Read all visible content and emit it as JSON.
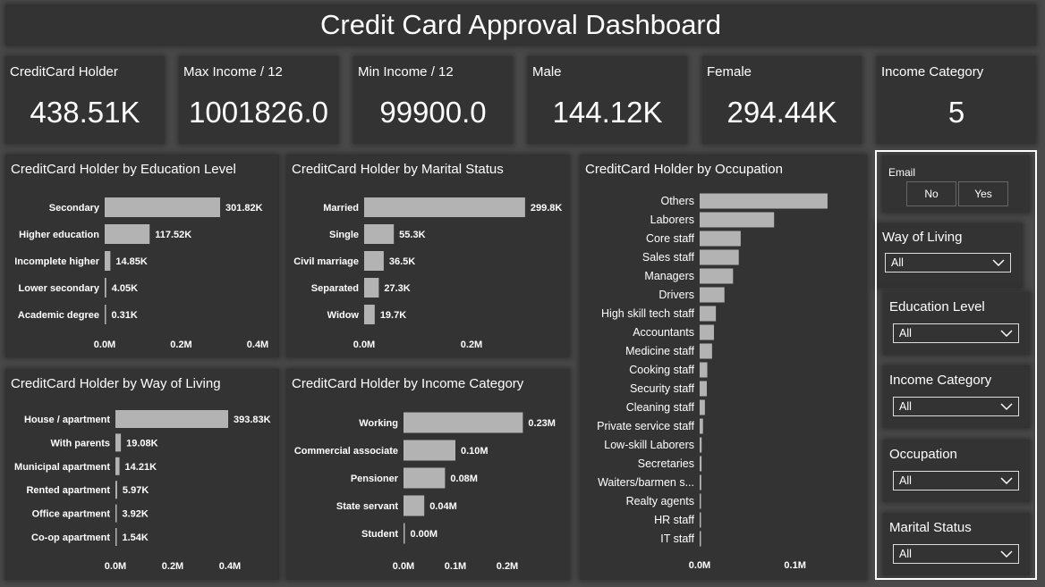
{
  "title": "Credit Card Approval Dashboard",
  "kpis": [
    {
      "label": "CreditCard Holder",
      "value": "438.51K"
    },
    {
      "label": "Max Income / 12",
      "value": "1001826.0"
    },
    {
      "label": "Min Income / 12",
      "value": "99900.0"
    },
    {
      "label": "Male",
      "value": "144.12K"
    },
    {
      "label": "Female",
      "value": "294.44K"
    },
    {
      "label": "Income Category",
      "value": "5"
    }
  ],
  "colors": {
    "background": "#4a4a4a",
    "panel": "#333333",
    "bar": "#b3b3b3",
    "text": "#ffffff"
  },
  "chart_data": [
    {
      "type": "bar",
      "orientation": "horizontal",
      "title": "CreditCard Holder by Education Level",
      "categories": [
        "Secondary",
        "Higher education",
        "Incomplete higher",
        "Lower secondary",
        "Academic degree"
      ],
      "values": [
        301820,
        117520,
        14850,
        4050,
        310
      ],
      "data_labels": [
        "301.82K",
        "117.52K",
        "14.85K",
        "4.05K",
        "0.31K"
      ],
      "xlim": [
        0,
        400000
      ],
      "xticks": [
        0,
        200000,
        400000
      ],
      "xtick_labels": [
        "0.0M",
        "0.2M",
        "0.4M"
      ],
      "grid": false
    },
    {
      "type": "bar",
      "orientation": "horizontal",
      "title": "CreditCard Holder by Marital Status",
      "categories": [
        "Married",
        "Single",
        "Civil marriage",
        "Separated",
        "Widow"
      ],
      "values": [
        299800,
        55300,
        36500,
        27300,
        19700
      ],
      "data_labels": [
        "299.8K",
        "55.3K",
        "36.5K",
        "27.3K",
        "19.7K"
      ],
      "xlim": [
        0,
        300000
      ],
      "xticks": [
        0,
        200000
      ],
      "xtick_labels": [
        "0.0M",
        "0.2M"
      ],
      "grid": false
    },
    {
      "type": "bar",
      "orientation": "horizontal",
      "title": "CreditCard Holder by Occupation",
      "categories": [
        "Others",
        "Laborers",
        "Core staff",
        "Sales staff",
        "Managers",
        "Drivers",
        "High skill tech staff",
        "Accountants",
        "Medicine staff",
        "Cooking staff",
        "Security staff",
        "Cleaning staff",
        "Private service staff",
        "Low-skill Laborers",
        "Secretaries",
        "Waiters/barmen s...",
        "Realty agents",
        "HR staff",
        "IT staff"
      ],
      "values": [
        134000,
        78000,
        43000,
        41000,
        35000,
        26000,
        17000,
        15000,
        13000,
        8000,
        7500,
        5500,
        3500,
        2100,
        2000,
        1700,
        1000,
        800,
        60
      ],
      "xlim": [
        0,
        150000
      ],
      "xticks": [
        0,
        100000
      ],
      "xtick_labels": [
        "0.0M",
        "0.1M"
      ],
      "grid": false
    },
    {
      "type": "bar",
      "orientation": "horizontal",
      "title": "CreditCard Holder by Way of Living",
      "categories": [
        "House / apartment",
        "With parents",
        "Municipal apartment",
        "Rented apartment",
        "Office apartment",
        "Co-op apartment"
      ],
      "values": [
        393830,
        19080,
        14210,
        5970,
        3920,
        1540
      ],
      "data_labels": [
        "393.83K",
        "19.08K",
        "14.21K",
        "5.97K",
        "3.92K",
        "1.54K"
      ],
      "xlim": [
        0,
        400000
      ],
      "xticks": [
        0,
        200000,
        400000
      ],
      "xtick_labels": [
        "0.0M",
        "0.2M",
        "0.4M"
      ],
      "grid": false
    },
    {
      "type": "bar",
      "orientation": "horizontal",
      "title": "CreditCard Holder by Income Category",
      "categories": [
        "Working",
        "Commercial associate",
        "Pensioner",
        "State servant",
        "Student"
      ],
      "values": [
        230000,
        100000,
        80000,
        40000,
        0
      ],
      "data_labels": [
        "0.23M",
        "0.10M",
        "0.08M",
        "0.04M",
        "0.00M"
      ],
      "xlim": [
        0,
        250000
      ],
      "xticks": [
        0,
        100000,
        200000
      ],
      "xtick_labels": [
        "0.0M",
        "0.1M",
        "0.2M"
      ],
      "grid": false
    }
  ],
  "slicers": {
    "email": {
      "title": "Email",
      "options": [
        "No",
        "Yes"
      ]
    },
    "dropdowns": [
      {
        "title": "Way of Living",
        "value": "All"
      },
      {
        "title": "Education Level",
        "value": "All"
      },
      {
        "title": "Income Category",
        "value": "All"
      },
      {
        "title": "Occupation",
        "value": "All"
      },
      {
        "title": "Marital Status",
        "value": "All"
      }
    ]
  }
}
